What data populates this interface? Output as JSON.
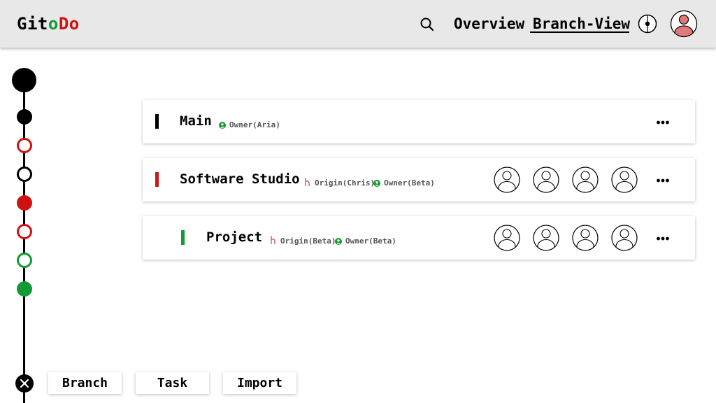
{
  "app": {
    "logo_parts": [
      "Git",
      "o",
      "D",
      "o"
    ],
    "colors": {
      "logo_text": "#000000",
      "logo_green": "#129b34",
      "logo_red": "#d01111",
      "red": "#d01111",
      "green": "#129b34",
      "header_bg": "#e8e8e8",
      "avatar_fill": "#e07a7a"
    }
  },
  "header": {
    "search_icon": "search-icon",
    "nav": [
      {
        "label": "Overview",
        "active": false
      },
      {
        "label": "Branch-View",
        "active": true
      }
    ],
    "compass_icon": "compass-icon",
    "avatar_icon": "user-avatar-icon"
  },
  "timeline": {
    "nodes": [
      {
        "style": "large-filled",
        "color": "#000000"
      },
      {
        "style": "filled",
        "color": "#000000"
      },
      {
        "style": "ring",
        "color": "#d01111"
      },
      {
        "style": "ring",
        "color": "#000000"
      },
      {
        "style": "filled",
        "color": "#d01111"
      },
      {
        "style": "ring",
        "color": "#d01111"
      },
      {
        "style": "ring",
        "color": "#129b34"
      },
      {
        "style": "filled",
        "color": "#129b34"
      }
    ],
    "close_icon": "close-icon"
  },
  "branches": [
    {
      "title": "Main",
      "color": "#000000",
      "tags": [
        {
          "icon": "owner-icon",
          "text": "Owner(Aria)"
        }
      ],
      "members": 0,
      "more_icon": "more-icon"
    },
    {
      "title": "Software Studio",
      "color": "#c81a1a",
      "tags": [
        {
          "icon": "origin-icon",
          "text": "Origin(Chris)"
        },
        {
          "icon": "owner-icon",
          "text": "Owner(Beta)"
        }
      ],
      "members": 4,
      "more_icon": "more-icon"
    },
    {
      "title": "Project",
      "color": "#129b34",
      "tags": [
        {
          "icon": "origin-icon",
          "text": "Origin(Beta)"
        },
        {
          "icon": "owner-icon",
          "text": "Owner(Beta)"
        }
      ],
      "members": 4,
      "more_icon": "more-icon"
    }
  ],
  "bottom_buttons": [
    {
      "label": "Branch"
    },
    {
      "label": "Task"
    },
    {
      "label": "Import"
    }
  ]
}
